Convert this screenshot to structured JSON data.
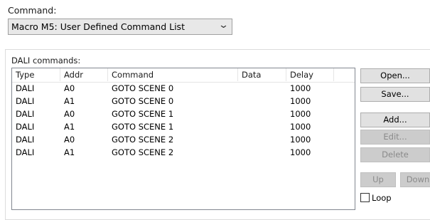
{
  "command": {
    "label": "Command:",
    "selected": "Macro M5: User Defined Command List",
    "chevron_icon": "chevron-down-icon"
  },
  "dali": {
    "group_label": "DALI commands:",
    "columns": [
      "Type",
      "Addr",
      "Command",
      "Data",
      "Delay",
      ""
    ],
    "rows": [
      {
        "type": "DALI",
        "addr": "A0",
        "command": "GOTO SCENE 0",
        "data": "",
        "delay": "1000"
      },
      {
        "type": "DALI",
        "addr": "A1",
        "command": "GOTO SCENE 0",
        "data": "",
        "delay": "1000"
      },
      {
        "type": "DALI",
        "addr": "A0",
        "command": "GOTO SCENE 1",
        "data": "",
        "delay": "1000"
      },
      {
        "type": "DALI",
        "addr": "A1",
        "command": "GOTO SCENE 1",
        "data": "",
        "delay": "1000"
      },
      {
        "type": "DALI",
        "addr": "A0",
        "command": "GOTO SCENE 2",
        "data": "",
        "delay": "1000"
      },
      {
        "type": "DALI",
        "addr": "A1",
        "command": "GOTO SCENE 2",
        "data": "",
        "delay": "1000"
      }
    ]
  },
  "buttons": {
    "open": "Open...",
    "save": "Save...",
    "add": "Add...",
    "edit": "Edit...",
    "delete": "Delete",
    "up": "Up",
    "down": "Down"
  },
  "loop": {
    "label": "Loop",
    "checked": false
  }
}
